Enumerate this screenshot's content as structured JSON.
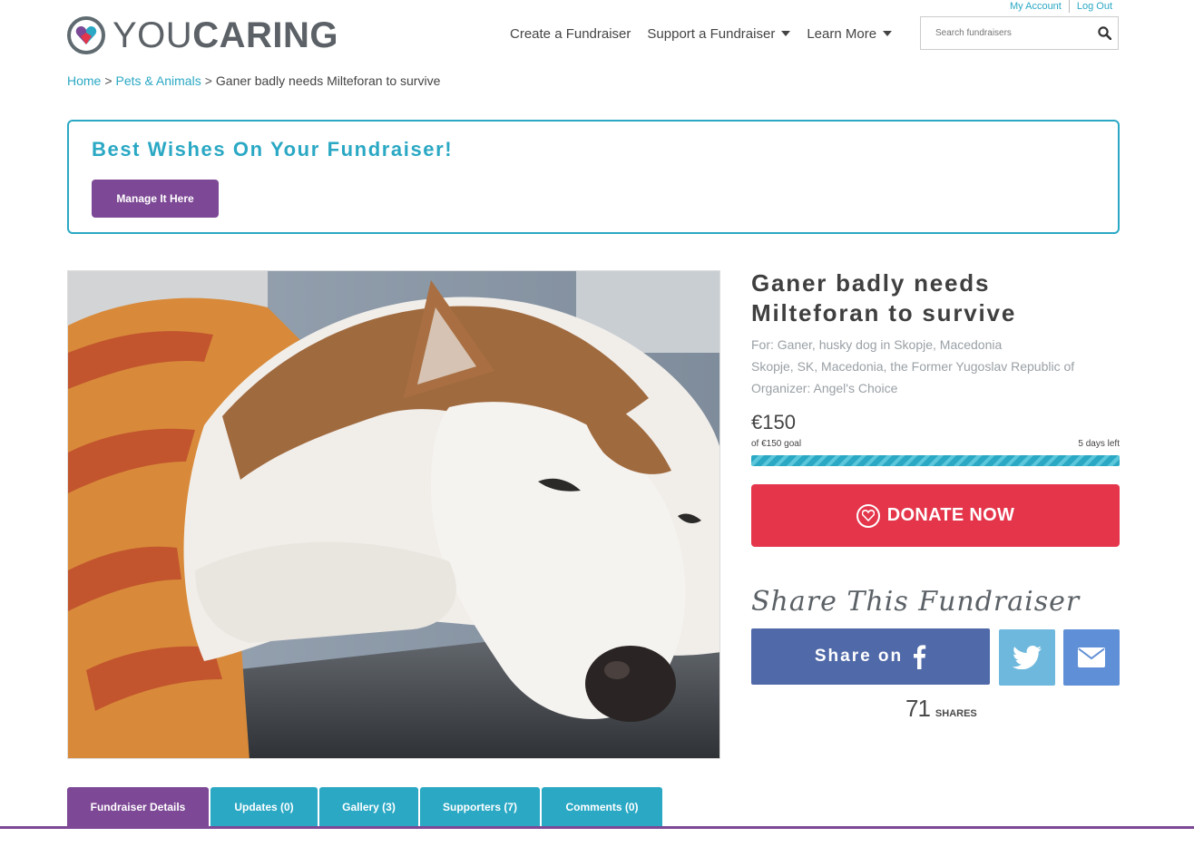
{
  "top_links": {
    "my_account": "My Account",
    "log_out": "Log Out"
  },
  "logo": {
    "you": "YOU",
    "caring": "CARING"
  },
  "nav": {
    "create": "Create a Fundraiser",
    "support": "Support a Fundraiser",
    "learn": "Learn More"
  },
  "search": {
    "placeholder": "Search fundraisers"
  },
  "breadcrumb": {
    "home": "Home",
    "category": "Pets & Animals",
    "current": "Ganer badly needs Milteforan to survive",
    "separator": ">"
  },
  "owner_box": {
    "title": "Best Wishes On Your Fundraiser!",
    "button": "Manage It Here"
  },
  "fundraiser": {
    "title_line1": "Ganer badly needs",
    "title_line2": "Milteforan to survive",
    "for": "For: Ganer, husky dog in Skopje, Macedonia",
    "location": "Skopje, SK, Macedonia, the Former Yugoslav Republic of",
    "organizer": "Organizer: Angel's Choice",
    "amount": "€150",
    "goal": "of €150 goal",
    "days_left": "5 days left",
    "progress_fraction": 1.0
  },
  "donate": {
    "label": "DONATE NOW"
  },
  "share": {
    "heading": "Share This Fundraiser",
    "facebook_label": "Share on",
    "count": "71",
    "count_label": "SHARES"
  },
  "tabs": [
    {
      "label": "Fundraiser Details"
    },
    {
      "label": "Updates (0)"
    },
    {
      "label": "Gallery (3)"
    },
    {
      "label": "Supporters (7)"
    },
    {
      "label": "Comments (0)"
    }
  ],
  "colors": {
    "accent_teal": "#2aa8c4",
    "accent_purple": "#7d4895",
    "donate_red": "#e4354a",
    "facebook": "#5069a8",
    "twitter": "#6fb8dd",
    "email": "#5f8fd6"
  },
  "icons": {
    "logo": "heart-logo-icon",
    "search": "search-icon",
    "donate": "heart-icon",
    "facebook": "facebook-icon",
    "twitter": "twitter-icon",
    "email": "envelope-icon"
  }
}
